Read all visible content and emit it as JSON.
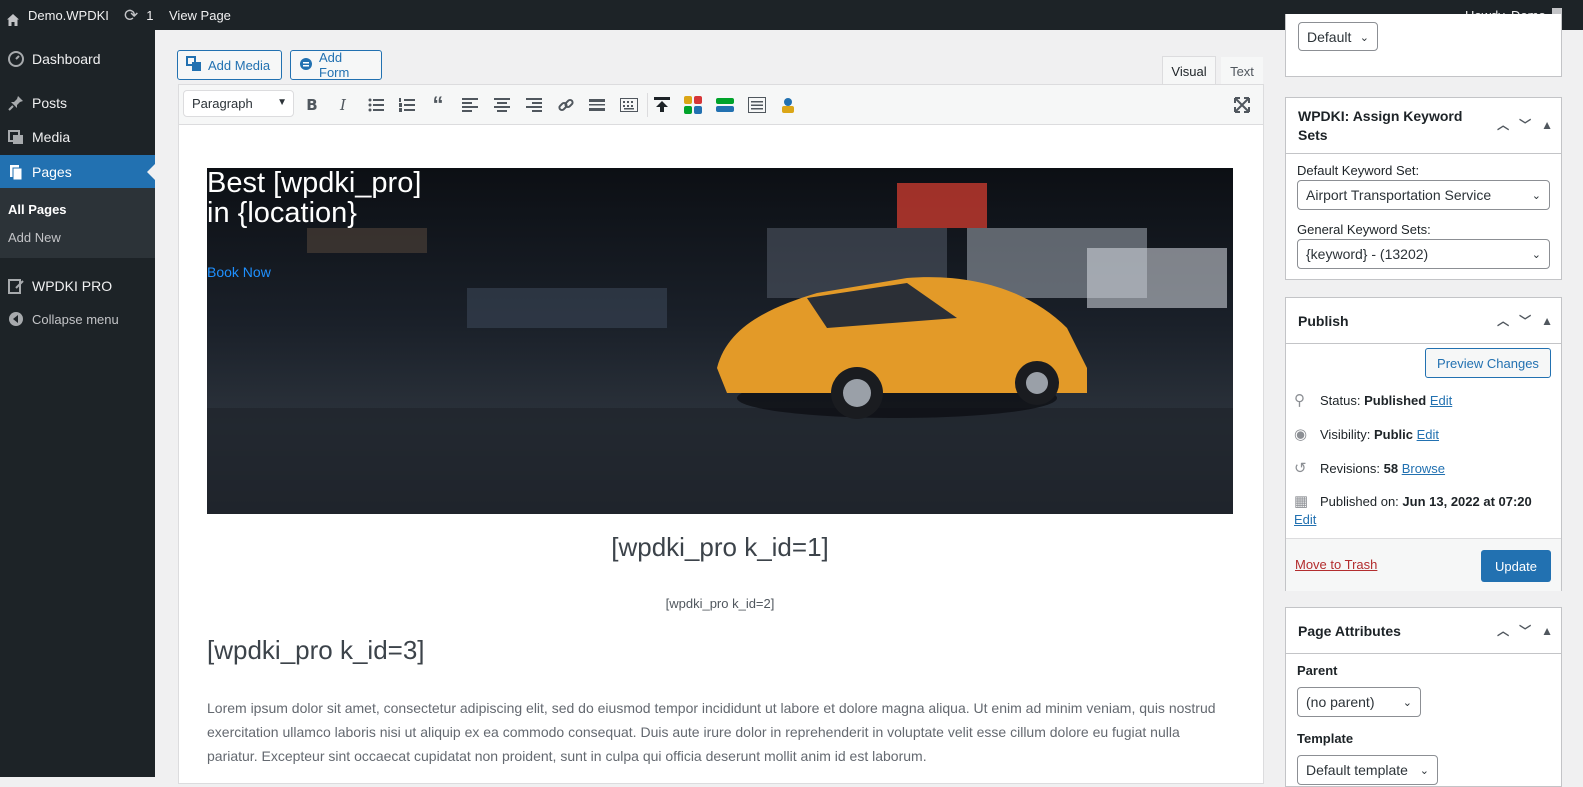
{
  "adminbar": {
    "site_name": "Demo.WPDKI",
    "updates_count": "1",
    "view_page": "View Page",
    "howdy": "Howdy, Demo"
  },
  "sidebar": {
    "dashboard": "Dashboard",
    "posts": "Posts",
    "media": "Media",
    "pages": "Pages",
    "all_pages": "All Pages",
    "add_new": "Add New",
    "wpdki_pro": "WPDKI PRO",
    "collapse": "Collapse menu"
  },
  "toolbar": {
    "add_media": "Add Media",
    "add_form": "Add Form",
    "tab_visual": "Visual",
    "tab_text": "Text",
    "format_select": "Paragraph"
  },
  "content": {
    "hero_line1": "Best [wpdki_pro]",
    "hero_line2": "in {location}",
    "book_now": "Book Now",
    "shortcode1": "[wpdki_pro k_id=1]",
    "shortcode2": "[wpdki_pro k_id=2]",
    "shortcode3": "[wpdki_pro k_id=3]",
    "paragraph": "Lorem ipsum dolor sit amet, consectetur adipiscing elit, sed do eiusmod tempor incididunt ut labore et dolore magna aliqua. Ut enim ad minim veniam, quis nostrud exercitation ullamco laboris nisi ut aliquip ex ea commodo consequat. Duis aute irure dolor in reprehenderit in voluptate velit esse cillum dolore eu fugiat nulla pariatur. Excepteur sint occaecat cupidatat non proident, sunt in culpa qui officia deserunt mollit anim id est laborum."
  },
  "top_panel": {
    "select_value": "Default"
  },
  "keyword_panel": {
    "title": "WPDKI: Assign Keyword Sets",
    "default_label": "Default Keyword Set:",
    "default_value": "Airport Transportation Service",
    "general_label": "General Keyword Sets:",
    "general_value": "{keyword} - (13202)"
  },
  "publish_panel": {
    "title": "Publish",
    "preview": "Preview Changes",
    "status_label": "Status:",
    "status_value": "Published",
    "edit": "Edit",
    "visibility_label": "Visibility:",
    "visibility_value": "Public",
    "revisions_label": "Revisions:",
    "revisions_value": "58",
    "browse": "Browse",
    "published_label": "Published on:",
    "published_value": "Jun 13, 2022 at 07:20",
    "trash": "Move to Trash",
    "update": "Update"
  },
  "attributes_panel": {
    "title": "Page Attributes",
    "parent_label": "Parent",
    "parent_value": "(no parent)",
    "template_label": "Template",
    "template_value": "Default template"
  },
  "colors": {
    "accent": "#2271b1",
    "admin_dark": "#1d2327",
    "active_menu": "#2271b1"
  }
}
